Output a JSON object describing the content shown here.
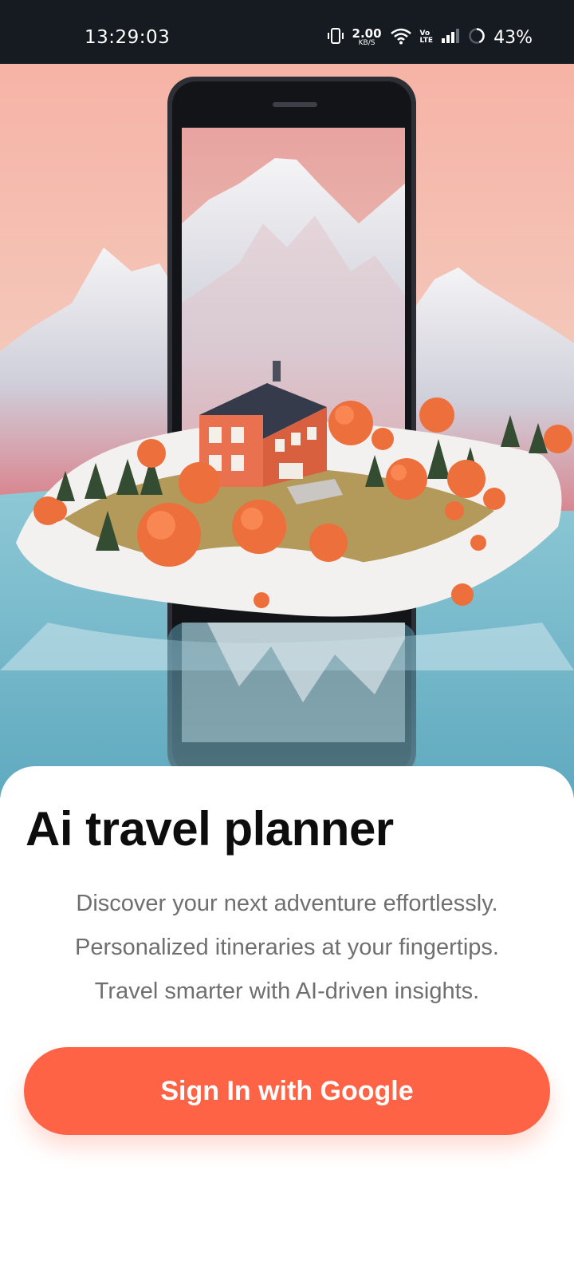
{
  "status_bar": {
    "time": "13:29:03",
    "net_speed_value": "2.00",
    "net_speed_unit": "KB/S",
    "volte_top": "Vo",
    "volte_bottom": "LTE",
    "battery": "43%",
    "icons": [
      "vibrate-icon",
      "wifi-icon",
      "signal-icon",
      "battery-ring-icon"
    ]
  },
  "hero": {
    "illustration": "phone-screen-with-snowy-mountains-and-red-house-on-island"
  },
  "main": {
    "title": "Ai travel planner",
    "taglines": [
      "Discover your next adventure effortlessly.",
      "Personalized itineraries at your fingertips.",
      "Travel smarter with AI-driven insights."
    ],
    "cta_label": "Sign In with Google"
  },
  "colors": {
    "accent": "#fe6345",
    "status_bar_bg": "#161b22",
    "title": "#0d0d0d",
    "tagline": "#6f6f6f"
  }
}
